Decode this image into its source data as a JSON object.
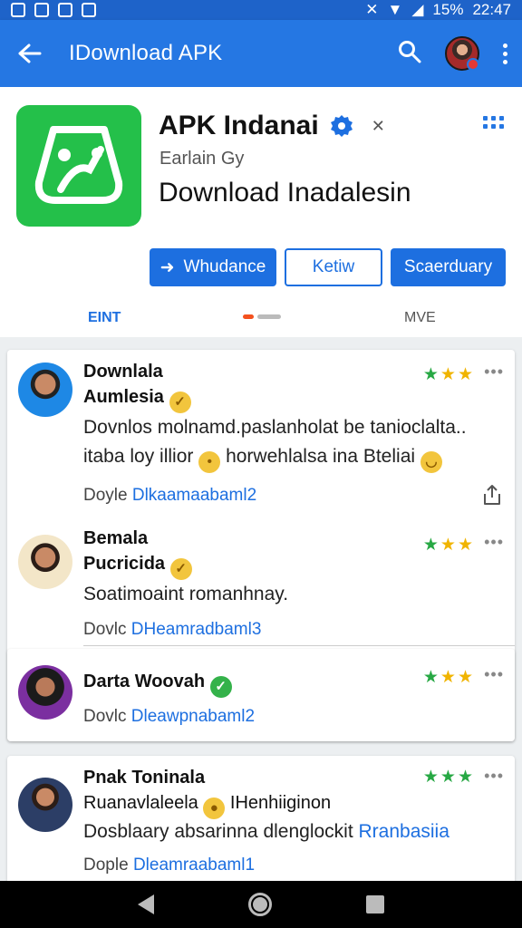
{
  "status_bar": {
    "battery": "15%",
    "time": "22:47"
  },
  "app_bar": {
    "title": "IDownload APK",
    "back_icon": "arrow-left-icon",
    "search_icon": "search-icon",
    "menu_icon": "more-vert-icon"
  },
  "app": {
    "name": "APK Indanai",
    "subtitle": "Earlain Gy",
    "tagline": "Download Inadalesin",
    "brand_color": "#24c04a",
    "accent_color": "#1d6fe0"
  },
  "actions": {
    "primary_label": "Whudance",
    "outline_label": "Ketiw",
    "secondary_label": "Scaerduary"
  },
  "tabs": {
    "left": "EINT",
    "right": "MVE"
  },
  "reviews": [
    {
      "name_line1": "Downlala",
      "name_line2": "Aumlesia",
      "body_line1": "Dovnlos molnamd.paslanholat be tanioclalta..",
      "body_line2_a": "itaba loy illior",
      "body_line2_b": "horwehlalsa ina Bteliai",
      "meta_prefix": "Doyle",
      "meta_link": "Dlkaamaabaml2",
      "rating": 3
    },
    {
      "name_line1": "Bemala",
      "name_line2": "Pucricida",
      "body_line1": "Soatimoaint romanhnay.",
      "meta_prefix": "Dovlc",
      "meta_link": "DHeamradbaml3",
      "rating": 3
    },
    {
      "name_line1": "Darta Woovah",
      "meta_prefix": "Dovlc",
      "meta_link": "Dleawpnabaml2",
      "rating": 3
    },
    {
      "name_line1": "Pnak Toninala",
      "name_line2_a": "Ruanavlaleela",
      "name_line2_b": "IHenhiiginon",
      "body_line1_a": "Dosblaary absarinna dlenglockit",
      "body_line1_link": "Rranbasiia",
      "meta_prefix": "Dople",
      "meta_link": "Dleamraabaml1",
      "rating": 3
    }
  ]
}
